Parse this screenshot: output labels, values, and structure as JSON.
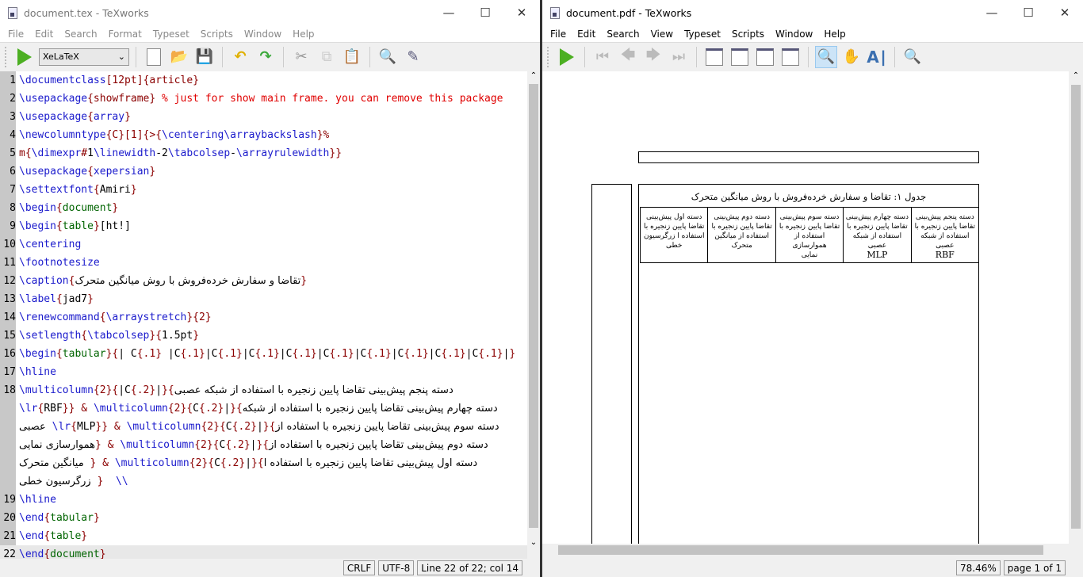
{
  "editor_window": {
    "title": "document.tex - TeXworks",
    "menu": [
      "File",
      "Edit",
      "Search",
      "Format",
      "Typeset",
      "Scripts",
      "Window",
      "Help"
    ],
    "engine": "XeLaTeX",
    "toolbar_icons": [
      "typeset-icon",
      "new-icon",
      "open-icon",
      "save-icon",
      "undo-icon",
      "redo-icon",
      "cut-icon",
      "copy-icon",
      "paste-icon",
      "find-icon",
      "replace-icon"
    ],
    "lines": [
      {
        "n": "1",
        "s": [
          [
            "cmd",
            "\\documentclass"
          ],
          [
            "br",
            "[12pt]{article}"
          ]
        ]
      },
      {
        "n": "2",
        "s": [
          [
            "cmd",
            "\\usepackage"
          ],
          [
            "br",
            "{"
          ],
          [
            "br",
            "showframe"
          ],
          [
            "br",
            "}"
          ],
          [
            "cm",
            " % just for show main frame. you can remove this package"
          ]
        ]
      },
      {
        "n": "3",
        "s": [
          [
            "cmd",
            "\\usepackage"
          ],
          [
            "br",
            "{"
          ],
          [
            "cmd",
            "array"
          ],
          [
            "br",
            "}"
          ]
        ]
      },
      {
        "n": "4",
        "s": [
          [
            "cmd",
            "\\newcolumntype"
          ],
          [
            "br",
            "{C}[1]{>{"
          ],
          [
            "cmd",
            "\\centering\\arraybackslash"
          ],
          [
            "br",
            "}%"
          ]
        ]
      },
      {
        "n": "5",
        "s": [
          [
            "br",
            "m{"
          ],
          [
            "cmd",
            "\\dimexpr"
          ],
          [
            "br",
            "#"
          ],
          [
            "pl",
            "1"
          ],
          [
            "cmd",
            "\\linewidth"
          ],
          [
            "pl",
            "-2"
          ],
          [
            "cmd",
            "\\tabcolsep"
          ],
          [
            "pl",
            "-"
          ],
          [
            "cmd",
            "\\arrayrulewidth"
          ],
          [
            "br",
            "}}"
          ]
        ]
      },
      {
        "n": "6",
        "s": [
          [
            "cmd",
            "\\usepackage"
          ],
          [
            "br",
            "{"
          ],
          [
            "cmd",
            "xepersian"
          ],
          [
            "br",
            "}"
          ]
        ]
      },
      {
        "n": "7",
        "s": [
          [
            "cmd",
            "\\settextfont"
          ],
          [
            "br",
            "{"
          ],
          [
            "pl",
            "Amiri"
          ],
          [
            "br",
            "}"
          ]
        ]
      },
      {
        "n": "8",
        "s": [
          [
            "cmd",
            "\\begin"
          ],
          [
            "br",
            "{"
          ],
          [
            "env",
            "document"
          ],
          [
            "br",
            "}"
          ]
        ]
      },
      {
        "n": "9",
        "s": [
          [
            "cmd",
            "\\begin"
          ],
          [
            "br",
            "{"
          ],
          [
            "env",
            "table"
          ],
          [
            "br",
            "}"
          ],
          [
            "pl",
            "[ht!]"
          ]
        ]
      },
      {
        "n": "10",
        "s": [
          [
            "cmd",
            "\\centering"
          ]
        ]
      },
      {
        "n": "11",
        "s": [
          [
            "cmd",
            "\\footnotesize"
          ]
        ]
      },
      {
        "n": "12",
        "s": [
          [
            "cmd",
            "\\caption"
          ],
          [
            "br",
            "{"
          ],
          [
            "fa",
            "تقاضا و سفارش خرده‌فروش با روش میانگین متحرک"
          ],
          [
            "br",
            "}"
          ]
        ]
      },
      {
        "n": "13",
        "s": [
          [
            "cmd",
            "\\label"
          ],
          [
            "br",
            "{"
          ],
          [
            "pl",
            "jad7"
          ],
          [
            "br",
            "}"
          ]
        ]
      },
      {
        "n": "14",
        "s": [
          [
            "cmd",
            "\\renewcommand"
          ],
          [
            "br",
            "{"
          ],
          [
            "cmd",
            "\\arraystretch"
          ],
          [
            "br",
            "}{2}"
          ]
        ]
      },
      {
        "n": "15",
        "s": [
          [
            "cmd",
            "\\setlength"
          ],
          [
            "br",
            "{"
          ],
          [
            "cmd",
            "\\tabcolsep"
          ],
          [
            "br",
            "}{"
          ],
          [
            "pl",
            "1.5pt"
          ],
          [
            "br",
            "}"
          ]
        ]
      },
      {
        "n": "16",
        "s": [
          [
            "cmd",
            "\\begin"
          ],
          [
            "br",
            "{"
          ],
          [
            "env",
            "tabular"
          ],
          [
            "br",
            "}{"
          ],
          [
            "pl",
            "| C"
          ],
          [
            "br",
            "{.1}"
          ],
          [
            "pl",
            " |C"
          ],
          [
            "br",
            "{.1}"
          ],
          [
            "pl",
            "|C"
          ],
          [
            "br",
            "{.1}"
          ],
          [
            "pl",
            "|C"
          ],
          [
            "br",
            "{.1}"
          ],
          [
            "pl",
            "|C"
          ],
          [
            "br",
            "{.1}"
          ],
          [
            "pl",
            "|C"
          ],
          [
            "br",
            "{.1}"
          ],
          [
            "pl",
            "|C"
          ],
          [
            "br",
            "{.1}"
          ],
          [
            "pl",
            "|C"
          ],
          [
            "br",
            "{.1}"
          ],
          [
            "pl",
            "|C"
          ],
          [
            "br",
            "{.1}"
          ],
          [
            "pl",
            "|C"
          ],
          [
            "br",
            "{.1}"
          ],
          [
            "pl",
            "|"
          ],
          [
            "br",
            "}"
          ]
        ]
      },
      {
        "n": "17",
        "s": [
          [
            "cmd",
            "\\hline"
          ]
        ]
      },
      {
        "n": "18",
        "s": [
          [
            "cmd",
            "\\multicolumn"
          ],
          [
            "br",
            "{2}{"
          ],
          [
            "pl",
            "|C"
          ],
          [
            "br",
            "{.2}"
          ],
          [
            "pl",
            "|"
          ],
          [
            "br",
            "}{"
          ],
          [
            "fa",
            "دسته پنجم پیش‌بینی تقاضا پایین زنجیره با استفاده از شبکه عصبی"
          ]
        ]
      },
      {
        "n": "",
        "s": [
          [
            "cmd",
            "\\lr"
          ],
          [
            "br",
            "{"
          ],
          [
            "pl",
            "RBF"
          ],
          [
            "br",
            "}}"
          ],
          [
            "br",
            " & "
          ],
          [
            "cmd",
            "\\multicolumn"
          ],
          [
            "br",
            "{2}{"
          ],
          [
            "pl",
            "C"
          ],
          [
            "br",
            "{.2}"
          ],
          [
            "pl",
            "|"
          ],
          [
            "br",
            "}{"
          ],
          [
            "fa",
            "دسته چهارم پیش‌بینی تقاضا پایین زنجیره با استفاده از شبکه"
          ]
        ]
      },
      {
        "n": "",
        "s": [
          [
            "fa",
            "عصبی"
          ],
          [
            "pl",
            " "
          ],
          [
            "cmd",
            "\\lr"
          ],
          [
            "br",
            "{"
          ],
          [
            "pl",
            "MLP"
          ],
          [
            "br",
            "}}"
          ],
          [
            "br",
            " & "
          ],
          [
            "cmd",
            "\\multicolumn"
          ],
          [
            "br",
            "{2}{"
          ],
          [
            "pl",
            "C"
          ],
          [
            "br",
            "{.2}"
          ],
          [
            "pl",
            "|"
          ],
          [
            "br",
            "}{"
          ],
          [
            "fa",
            "دسته سوم پیش‌بینی تقاضا پایین زنجیره با استفاده از"
          ]
        ]
      },
      {
        "n": "",
        "s": [
          [
            "fa",
            "هموارسازی نمایی"
          ],
          [
            "br",
            "}"
          ],
          [
            "br",
            " & "
          ],
          [
            "cmd",
            "\\multicolumn"
          ],
          [
            "br",
            "{2}{"
          ],
          [
            "pl",
            "C"
          ],
          [
            "br",
            "{.2}"
          ],
          [
            "pl",
            "|"
          ],
          [
            "br",
            "}{"
          ],
          [
            "fa",
            "دسته دوم پیش‌بینی تقاضا پایین زنجیره با استفاده از"
          ]
        ]
      },
      {
        "n": "",
        "s": [
          [
            "fa",
            "میانگین متحرک"
          ],
          [
            "br",
            " }"
          ],
          [
            "br",
            " & "
          ],
          [
            "cmd",
            "\\multicolumn"
          ],
          [
            "br",
            "{2}{"
          ],
          [
            "pl",
            "C"
          ],
          [
            "br",
            "{.2}"
          ],
          [
            "pl",
            "|"
          ],
          [
            "br",
            "}{"
          ],
          [
            "fa",
            "دسته اول پیش‌بینی تقاضا پایین زنجیره با استفاده ا"
          ]
        ]
      },
      {
        "n": "",
        "s": [
          [
            "fa",
            "زرگرسیون خطی"
          ],
          [
            "br",
            " }"
          ],
          [
            "cmd",
            "  \\\\"
          ]
        ]
      },
      {
        "n": "19",
        "s": [
          [
            "cmd",
            "\\hline"
          ]
        ]
      },
      {
        "n": "20",
        "s": [
          [
            "cmd",
            "\\end"
          ],
          [
            "br",
            "{"
          ],
          [
            "env",
            "tabular"
          ],
          [
            "br",
            "}"
          ]
        ]
      },
      {
        "n": "21",
        "s": [
          [
            "cmd",
            "\\end"
          ],
          [
            "br",
            "{"
          ],
          [
            "env",
            "table"
          ],
          [
            "br",
            "}"
          ]
        ]
      },
      {
        "n": "22",
        "s": [
          [
            "cmd",
            "\\end"
          ],
          [
            "br",
            "{"
          ],
          [
            "env",
            "document"
          ],
          [
            "br",
            "}"
          ]
        ],
        "current": true
      }
    ],
    "status": {
      "line_ending": "CRLF",
      "encoding": "UTF-8",
      "position": "Line 22 of 22; col 14"
    }
  },
  "pdf_window": {
    "title": "document.pdf - TeXworks",
    "menu": [
      "File",
      "Edit",
      "Search",
      "View",
      "Typeset",
      "Scripts",
      "Window",
      "Help"
    ],
    "toolbar_icons": [
      "typeset-icon",
      "first-page-icon",
      "prev-page-icon",
      "next-page-icon",
      "last-page-icon",
      "actual-size-icon",
      "fit-width-icon",
      "fit-page-icon",
      "fit-window-icon",
      "magnify-icon",
      "scroll-hand-icon",
      "select-text-icon",
      "find-icon"
    ],
    "active_tool": "magnify-icon",
    "caption": "جدول ۱: تقاضا و سفارش خرده‌فروش با روش میانگین متحرک",
    "table_cells": [
      [
        "دسته پنجم پیش‌بینی",
        "تقاضا پایین زنجیره با",
        "استفاده از شبکه عصبی",
        "RBF"
      ],
      [
        "دسته چهارم پیش‌بینی",
        "تقاضا پایین زنجیره با",
        "استفاده از شبکه عصبی",
        "MLP"
      ],
      [
        "دسته سوم پیش‌بینی",
        "تقاضا پایین زنجیره با",
        "استفاده از هموارسازی",
        "نمایی"
      ],
      [
        "دسته دوم پیش‌بینی",
        "تقاضا پایین زنجیره با",
        "استفاده از میانگین",
        "متحرک"
      ],
      [
        "دسته اول پیش‌بینی",
        "تقاضا پایین زنجیره با",
        "استفاده ا زرگرسیون",
        "خطی"
      ]
    ],
    "status": {
      "zoom": "78.46%",
      "page": "page 1 of 1"
    }
  }
}
